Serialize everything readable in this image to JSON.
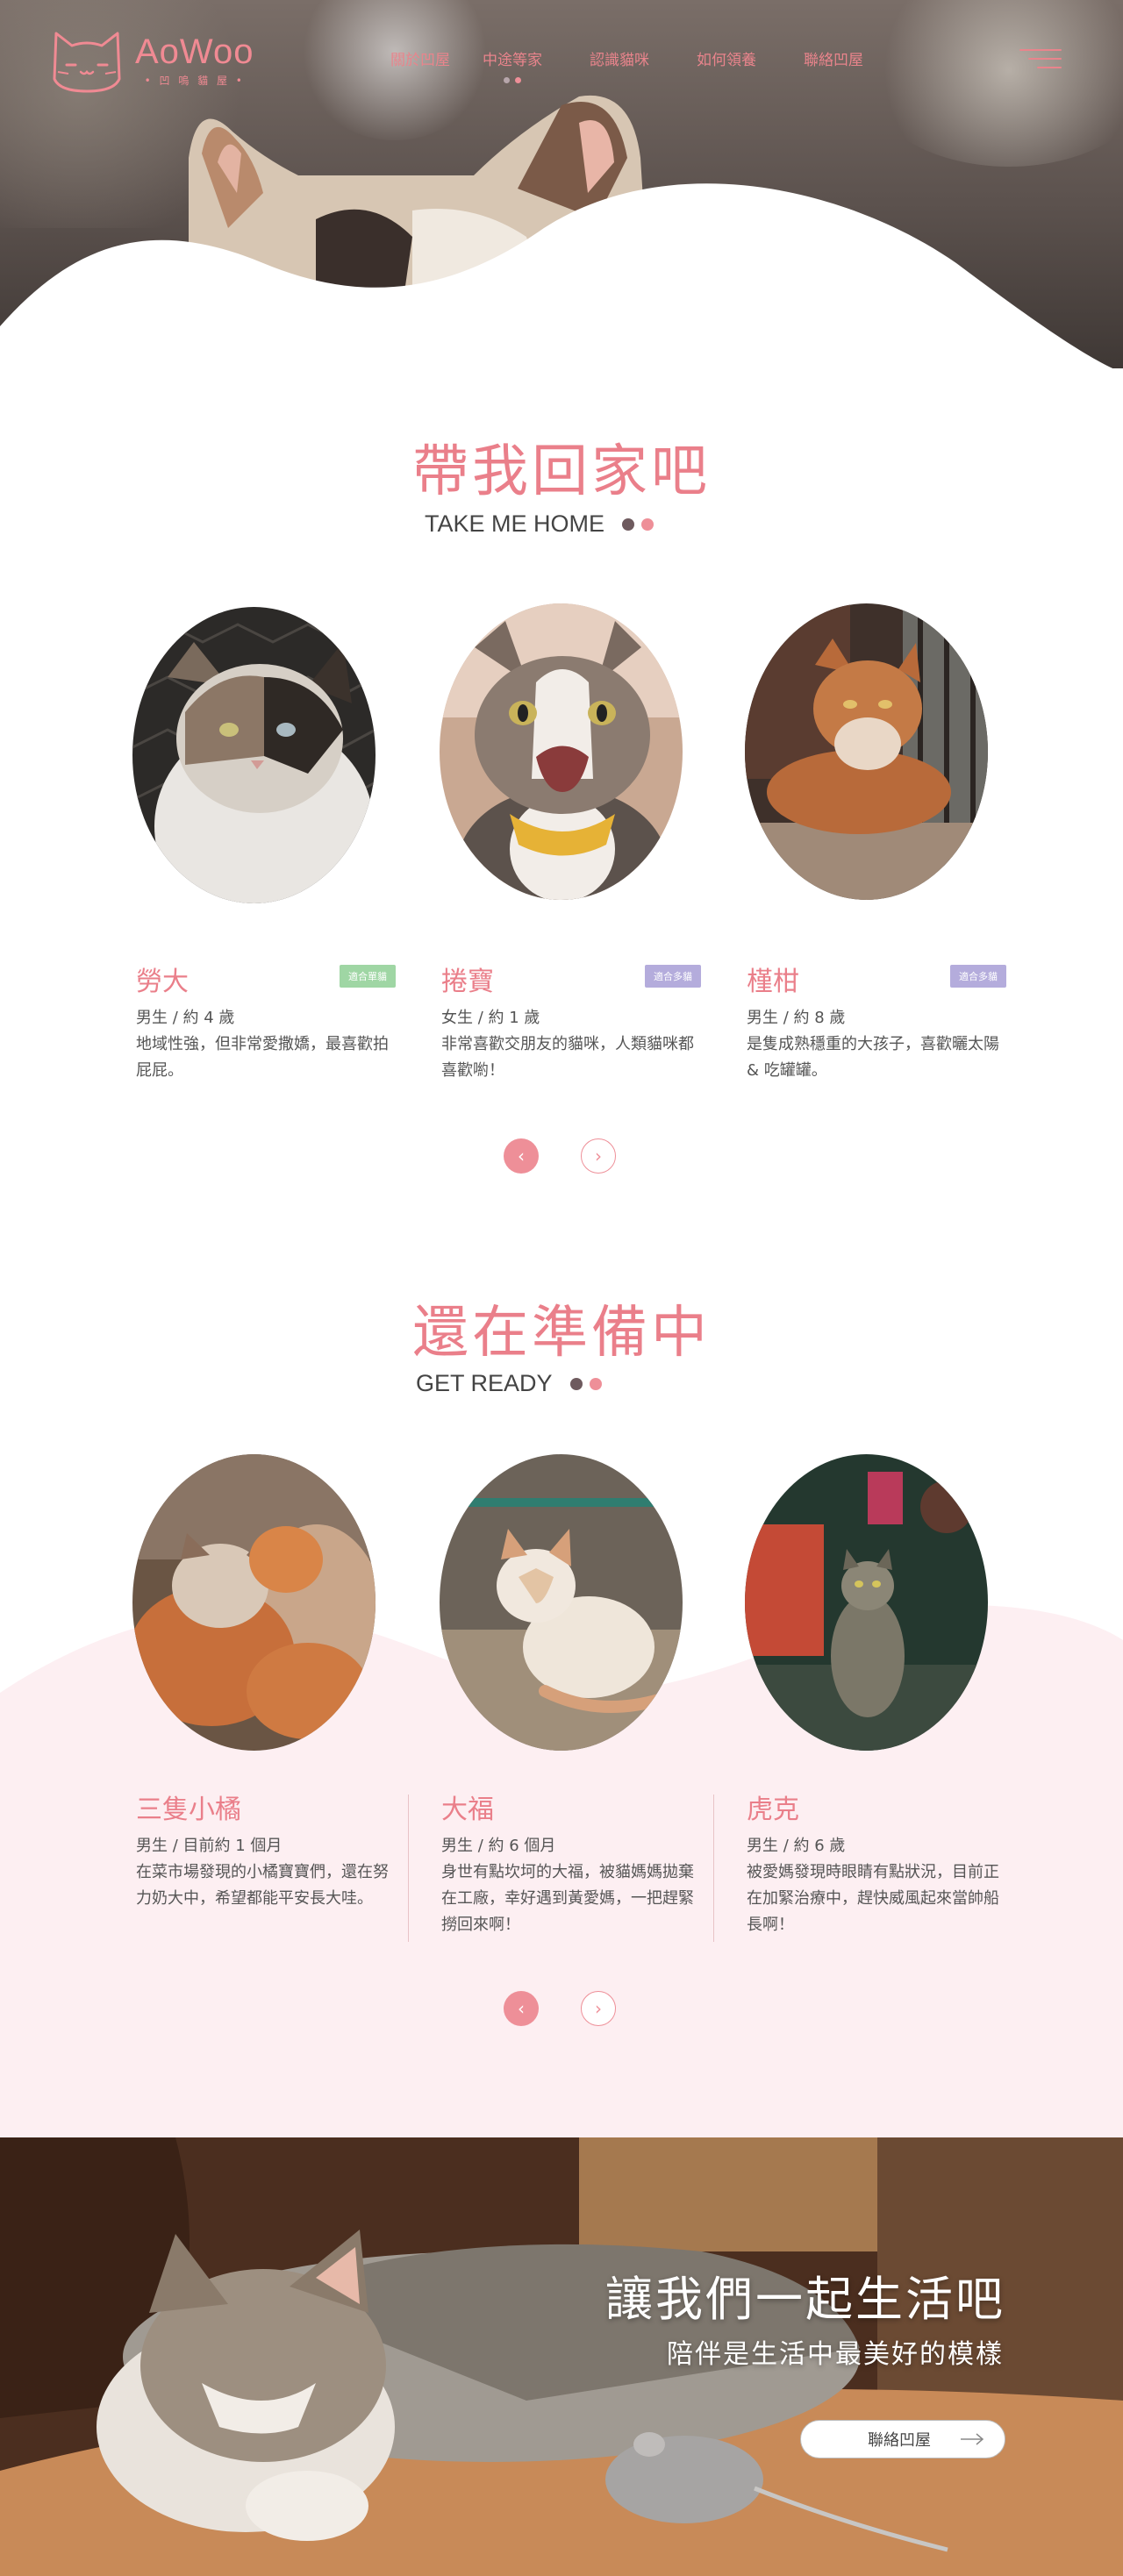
{
  "header": {
    "logo_name": "AoWoo",
    "logo_sub": "• 凹 嗚 貓 屋 •",
    "nav": [
      {
        "label": "關於凹屋"
      },
      {
        "label": "中途等家"
      },
      {
        "label": "認識貓咪"
      },
      {
        "label": "如何領養"
      },
      {
        "label": "聯絡凹屋"
      }
    ]
  },
  "take_me_home": {
    "title": "帶我回家吧",
    "subtitle": "TAKE ME HOME",
    "cards": [
      {
        "name": "勞大",
        "tag": "適合單貓",
        "meta": "男生 / 約 4 歲",
        "desc": "地域性強，但非常愛撒嬌，最喜歡拍屁屁。"
      },
      {
        "name": "捲寶",
        "tag": "適合多貓",
        "meta": "女生 / 約 1 歲",
        "desc": "非常喜歡交朋友的貓咪，人類貓咪都喜歡喲！"
      },
      {
        "name": "槿柑",
        "tag": "適合多貓",
        "meta": "男生 / 約 8 歲",
        "desc": "是隻成熟穩重的大孩子，喜歡曬太陽 & 吃罐罐。"
      }
    ],
    "prev": "‹",
    "next": "›"
  },
  "get_ready": {
    "title": "還在準備中",
    "subtitle": "GET READY",
    "cards": [
      {
        "name": "三隻小橘",
        "meta": "男生 / 目前約 1 個月",
        "desc": "在菜市場發現的小橘寶寶們，還在努力奶大中，希望都能平安長大哇。"
      },
      {
        "name": "大福",
        "meta": "男生 / 約 6 個月",
        "desc": "身世有點坎坷的大福，被貓媽媽拋棄在工廠，幸好遇到黃愛媽，一把趕緊撈回來啊！"
      },
      {
        "name": "虎克",
        "meta": "男生 / 約 6 歲",
        "desc": "被愛媽發現時眼睛有點狀況，目前正在加緊治療中，趕快威風起來當帥船長啊！"
      }
    ],
    "prev": "‹",
    "next": "›"
  },
  "banner": {
    "title": "讓我們一起生活吧",
    "subtitle": "陪伴是生活中最美好的模樣",
    "button": "聯絡凹屋"
  },
  "colors": {
    "accent": "#ea7f8a",
    "tag_single": "#9fd6a4",
    "tag_multi": "#b4acdc",
    "pink_bg": "#fdeff2",
    "dot_dark": "#6e5a5e"
  },
  "icons": [
    "cat-logo-icon",
    "hamburger-menu-icon",
    "chevron-left-icon",
    "chevron-right-icon",
    "arrow-right-icon"
  ]
}
